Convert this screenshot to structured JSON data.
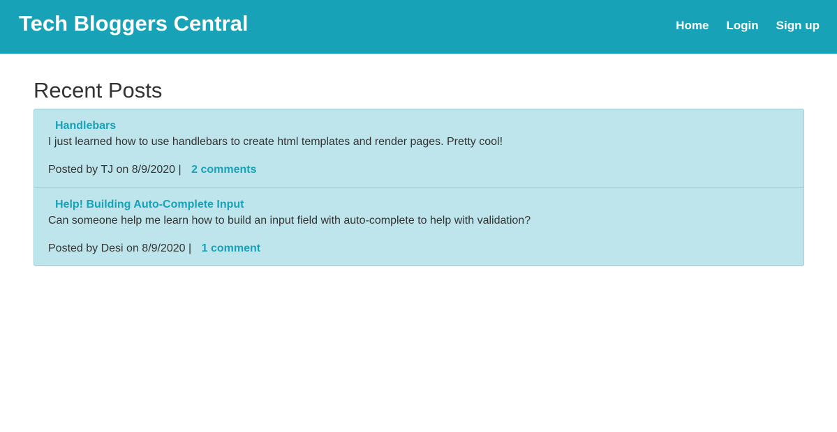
{
  "header": {
    "brand": "Tech Bloggers Central",
    "nav": {
      "home": "Home",
      "login": "Login",
      "signup": "Sign up"
    }
  },
  "main": {
    "title": "Recent Posts",
    "posts": [
      {
        "title": "Handlebars",
        "body": "I just learned how to use handlebars to create html templates and render pages. Pretty cool!",
        "meta": "Posted by TJ on 8/9/2020 |",
        "comments": "2 comments"
      },
      {
        "title": "Help! Building Auto-Complete Input",
        "body": "Can someone help me learn how to build an input field with auto-complete to help with validation?",
        "meta": "Posted by Desi on 8/9/2020 |",
        "comments": "1 comment"
      }
    ]
  },
  "colors": {
    "accent": "#17a2b8",
    "post_background": "#bee5eb",
    "text": "#333333"
  }
}
